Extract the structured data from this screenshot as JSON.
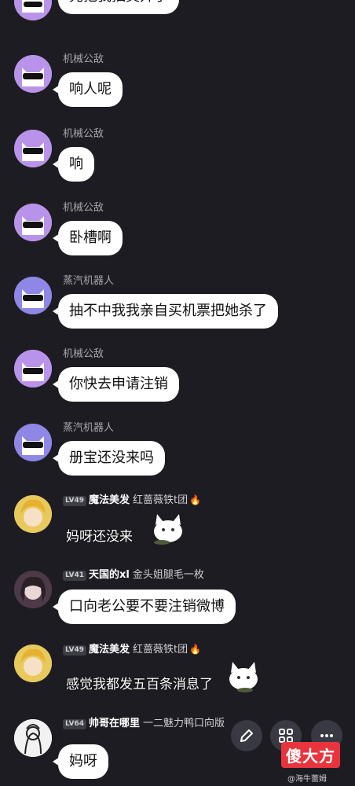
{
  "messages": [
    {
      "sender": "",
      "text": "先把我抽奖开了"
    },
    {
      "sender": "机械公敌",
      "text": "响人呢"
    },
    {
      "sender": "机械公敌",
      "text": "响"
    },
    {
      "sender": "机械公敌",
      "text": "卧槽啊"
    },
    {
      "sender": "蒸汽机器人",
      "text": "抽不中我我亲自买机票把她杀了"
    },
    {
      "sender": "机械公敌",
      "text": "你快去申请注销"
    },
    {
      "sender": "蒸汽机器人",
      "text": "册宝还没来吗"
    },
    {
      "level": "LV49",
      "nickname": "魔法美发",
      "title": "红蔷薇铁t团",
      "text": "妈呀还没来"
    },
    {
      "level": "LV41",
      "nickname": "天国的xl",
      "title": "金头姐腿毛一枚",
      "text": "口向老公要不要注销微博"
    },
    {
      "level": "LV49",
      "nickname": "魔法美发",
      "title": "红蔷薇铁t团",
      "text": "感觉我都发五百条消息了"
    },
    {
      "level": "LV64",
      "nickname": "帅哥在哪里",
      "title": "一二魅力鸭口向版",
      "text": "妈呀"
    }
  ],
  "actions": [
    {
      "icon": "pencil-icon"
    },
    {
      "icon": "grid-icon"
    },
    {
      "icon": "more-icon"
    }
  ],
  "watermark": {
    "logo": "傻大方",
    "weibo": "@海牛蕾姆"
  },
  "colors": {
    "background": "#1c1c22",
    "bubble": "#ffffff",
    "bot_avatar": "#b993e9",
    "flame": "#ff5a2d"
  }
}
